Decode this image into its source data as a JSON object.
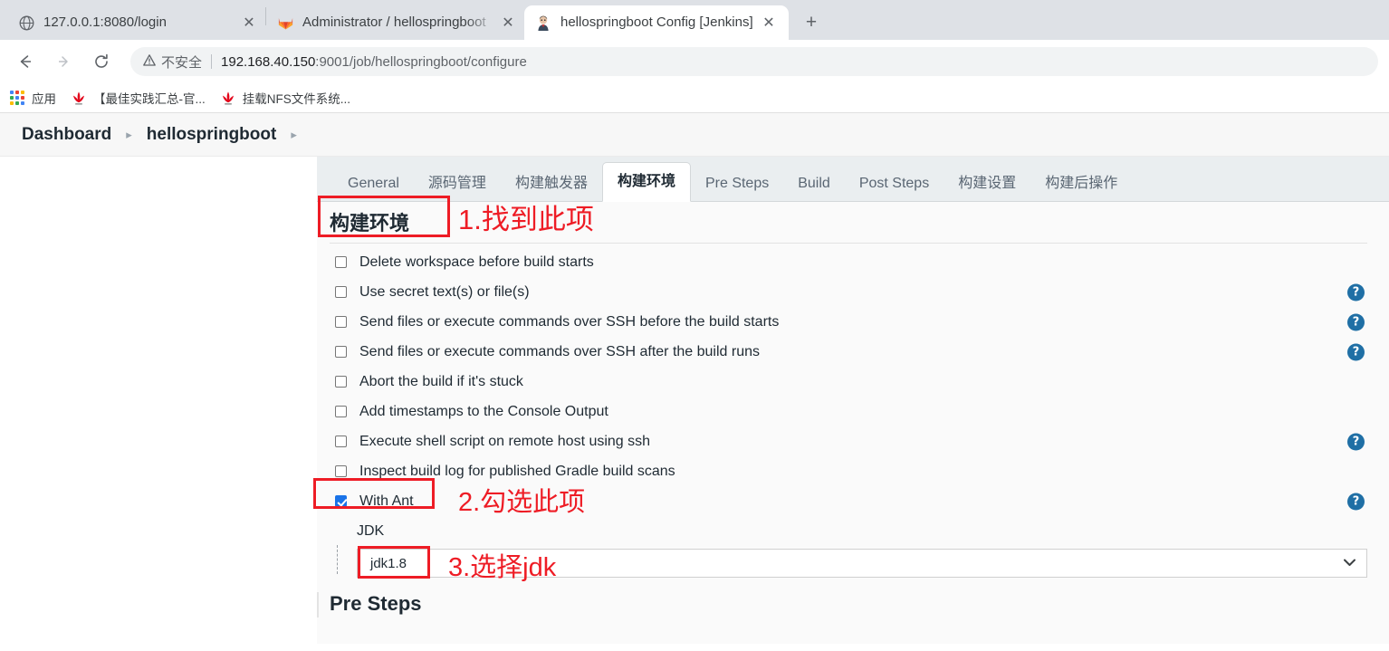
{
  "browser": {
    "tabs": [
      {
        "title": "127.0.0.1:8080/login",
        "favicon": "globe-icon",
        "active": false,
        "close_label": "✕"
      },
      {
        "title": "Administrator / hellospringboot",
        "favicon": "gitlab-icon",
        "active": false,
        "close_label": "✕"
      },
      {
        "title": "hellospringboot Config [Jenkins]",
        "favicon": "jenkins-icon",
        "active": true,
        "close_label": "✕"
      }
    ],
    "new_tab_label": "+",
    "toolbar": {
      "back_label": "←",
      "forward_label": "→",
      "reload_label": "⟳",
      "security_warning_icon": "warning-triangle-icon",
      "security_text": "不安全",
      "url_host": "192.168.40.150",
      "url_rest": ":9001/job/hellospringboot/configure"
    },
    "bookmarks": [
      {
        "label": "应用",
        "icon": "apps-grid-icon"
      },
      {
        "label": "【最佳实践汇总-官...",
        "icon": "huawei-icon"
      },
      {
        "label": "挂载NFS文件系统...",
        "icon": "huawei-icon"
      }
    ]
  },
  "jenkins": {
    "breadcrumb": [
      {
        "label": "Dashboard",
        "sep": "▸"
      },
      {
        "label": "hellospringboot",
        "sep": "▸"
      }
    ],
    "config_tabs": [
      {
        "label": "General",
        "selected": false
      },
      {
        "label": "源码管理",
        "selected": false
      },
      {
        "label": "构建触发器",
        "selected": false
      },
      {
        "label": "构建环境",
        "selected": true
      },
      {
        "label": "Pre Steps",
        "selected": false
      },
      {
        "label": "Build",
        "selected": false
      },
      {
        "label": "Post Steps",
        "selected": false
      },
      {
        "label": "构建设置",
        "selected": false
      },
      {
        "label": "构建后操作",
        "selected": false
      }
    ],
    "section_title": "构建环境",
    "options": [
      {
        "label": "Delete workspace before build starts",
        "checked": false,
        "help": false
      },
      {
        "label": "Use secret text(s) or file(s)",
        "checked": false,
        "help": true
      },
      {
        "label": "Send files or execute commands over SSH before the build starts",
        "checked": false,
        "help": true
      },
      {
        "label": "Send files or execute commands over SSH after the build runs",
        "checked": false,
        "help": true
      },
      {
        "label": "Abort the build if it's stuck",
        "checked": false,
        "help": false
      },
      {
        "label": "Add timestamps to the Console Output",
        "checked": false,
        "help": false
      },
      {
        "label": "Execute shell script on remote host using ssh",
        "checked": false,
        "help": true
      },
      {
        "label": "Inspect build log for published Gradle build scans",
        "checked": false,
        "help": false
      }
    ],
    "with_ant": {
      "label": "With Ant",
      "checked": true,
      "help": true
    },
    "jdk_label": "JDK",
    "jdk_value": "jdk1.8",
    "jdk_chevron": "⌄",
    "help_glyph": "?",
    "pre_steps_title": "Pre Steps"
  },
  "annotations": [
    {
      "text": "1.找到此项",
      "name": "annotation-step-1"
    },
    {
      "text": "2.勾选此项",
      "name": "annotation-step-2"
    },
    {
      "text": "3.选择jdk",
      "name": "annotation-step-3"
    }
  ],
  "colors": {
    "annotation_red": "#ee1c25",
    "help_blue": "#1f6fa5",
    "checkbox_blue": "#1a73e8",
    "tabbar_bg": "#eaeef0",
    "content_bg": "#fafafa"
  }
}
